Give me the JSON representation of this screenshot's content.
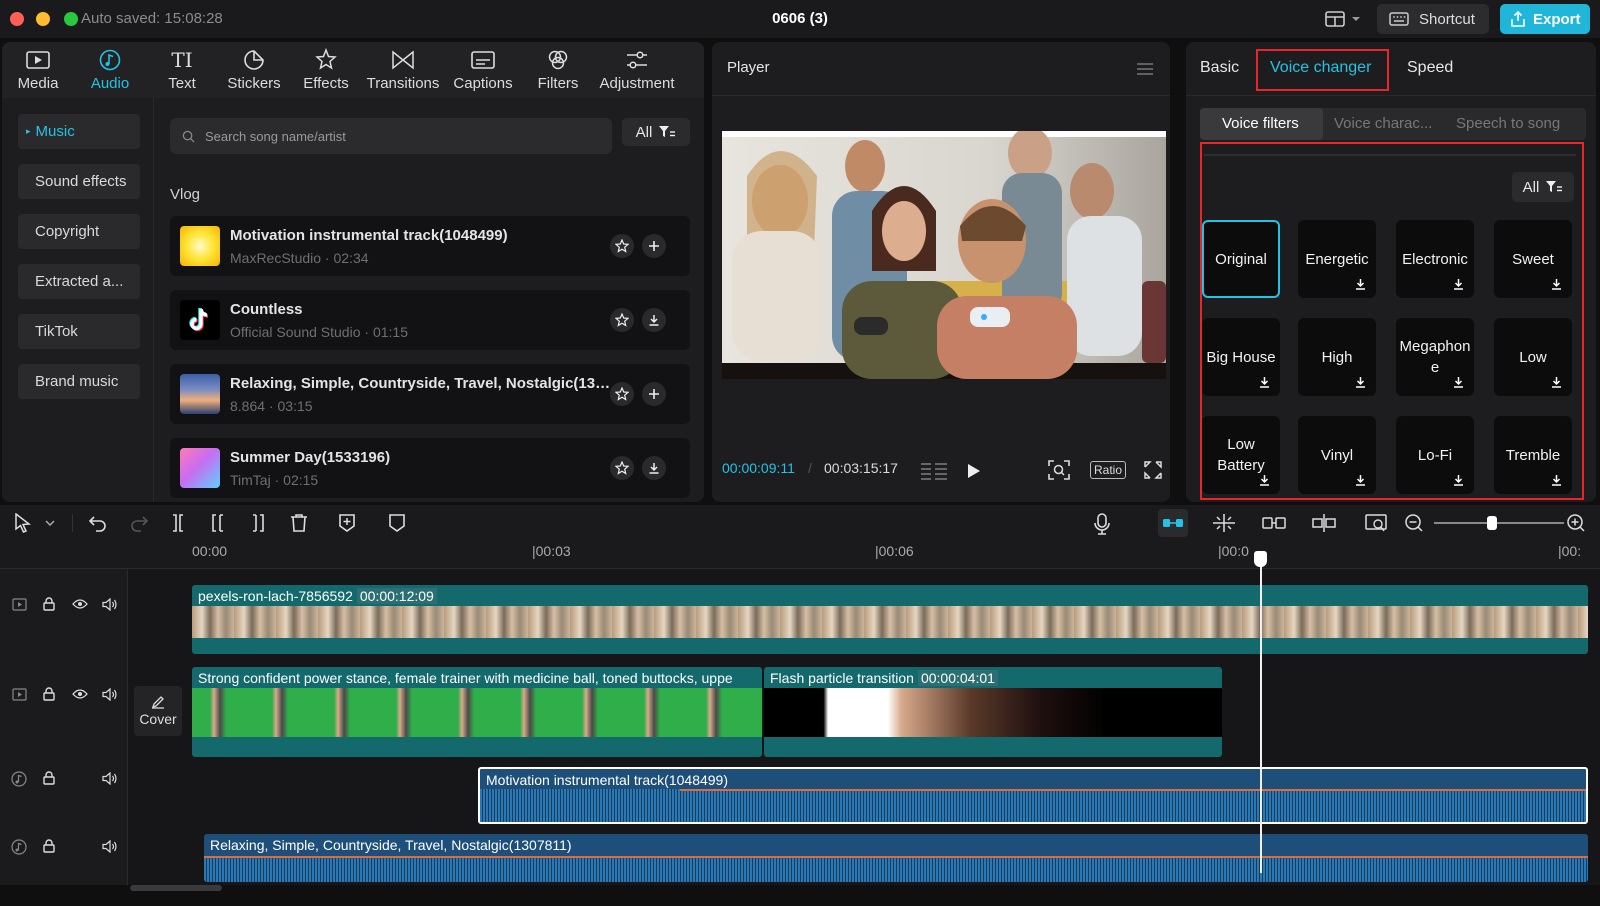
{
  "titlebar": {
    "autosave": "Auto saved: 15:08:28",
    "project_name": "0606 (3)",
    "shortcut_label": "Shortcut",
    "export_label": "Export"
  },
  "toolbar": {
    "tools": [
      {
        "label": "Media",
        "icon": "media-icon"
      },
      {
        "label": "Audio",
        "icon": "audio-icon",
        "active": true
      },
      {
        "label": "Text",
        "icon": "text-icon"
      },
      {
        "label": "Stickers",
        "icon": "stickers-icon"
      },
      {
        "label": "Effects",
        "icon": "effects-icon"
      },
      {
        "label": "Transitions",
        "icon": "transitions-icon"
      },
      {
        "label": "Captions",
        "icon": "captions-icon"
      },
      {
        "label": "Filters",
        "icon": "filters-icon"
      },
      {
        "label": "Adjustment",
        "icon": "adjustment-icon"
      }
    ]
  },
  "sidenav": {
    "items": [
      {
        "label": "Music",
        "active": true
      },
      {
        "label": "Sound effects"
      },
      {
        "label": "Copyright"
      },
      {
        "label": "Extracted a..."
      },
      {
        "label": "TikTok"
      },
      {
        "label": "Brand music"
      }
    ]
  },
  "library": {
    "search_placeholder": "Search song name/artist",
    "filter_label": "All",
    "section_title": "Vlog",
    "songs": [
      {
        "title": "Motivation instrumental track(1048499)",
        "artist": "MaxRecStudio",
        "duration": "02:34",
        "action": "add"
      },
      {
        "title": "Countless",
        "artist": "Official Sound Studio",
        "duration": "01:15",
        "action": "download"
      },
      {
        "title": "Relaxing, Simple, Countryside, Travel, Nostalgic(1307811)",
        "artist": "8.864",
        "duration": "03:15",
        "action": "add"
      },
      {
        "title": "Summer Day(1533196)",
        "artist": "TimTaj",
        "duration": "02:15",
        "action": "download"
      }
    ]
  },
  "player": {
    "title": "Player",
    "current_time": "00:00:09:11",
    "total_time": "00:03:15:17",
    "ratio_label": "Ratio"
  },
  "inspector": {
    "tabs": [
      "Basic",
      "Voice changer",
      "Speed"
    ],
    "active_tab": "Voice changer",
    "subtabs": [
      "Voice filters",
      "Voice charac...",
      "Speech to song"
    ],
    "filter_label": "All",
    "voice_filters": [
      {
        "label": "Original",
        "active": true
      },
      {
        "label": "Energetic"
      },
      {
        "label": "Electronic"
      },
      {
        "label": "Sweet"
      },
      {
        "label": "Big House"
      },
      {
        "label": "High"
      },
      {
        "label": "Megaphone"
      },
      {
        "label": "Low"
      },
      {
        "label": "Low Battery"
      },
      {
        "label": "Vinyl"
      },
      {
        "label": "Lo-Fi"
      },
      {
        "label": "Tremble"
      }
    ]
  },
  "timeline": {
    "ruler": [
      "00:00",
      "|00:03",
      "|00:06",
      "|00:0",
      "|00:"
    ],
    "cover_label": "Cover",
    "clips": {
      "main_video": {
        "name": "pexels-ron-lach-7856592",
        "duration": "00:00:12:09"
      },
      "overlay_video": {
        "name": "Strong confident power stance, female trainer with medicine ball, toned buttocks, uppe"
      },
      "transition": {
        "name": "Flash particle transition",
        "duration": "00:00:04:01"
      },
      "audio1": {
        "name": "Motivation instrumental track(1048499)"
      },
      "audio2": {
        "name": "Relaxing, Simple, Countryside, Travel, Nostalgic(1307811)"
      }
    }
  },
  "colors": {
    "accent": "#22c3e6",
    "highlight": "#e8262b",
    "video_clip": "#13696b",
    "audio_clip": "#1d4f7a"
  }
}
